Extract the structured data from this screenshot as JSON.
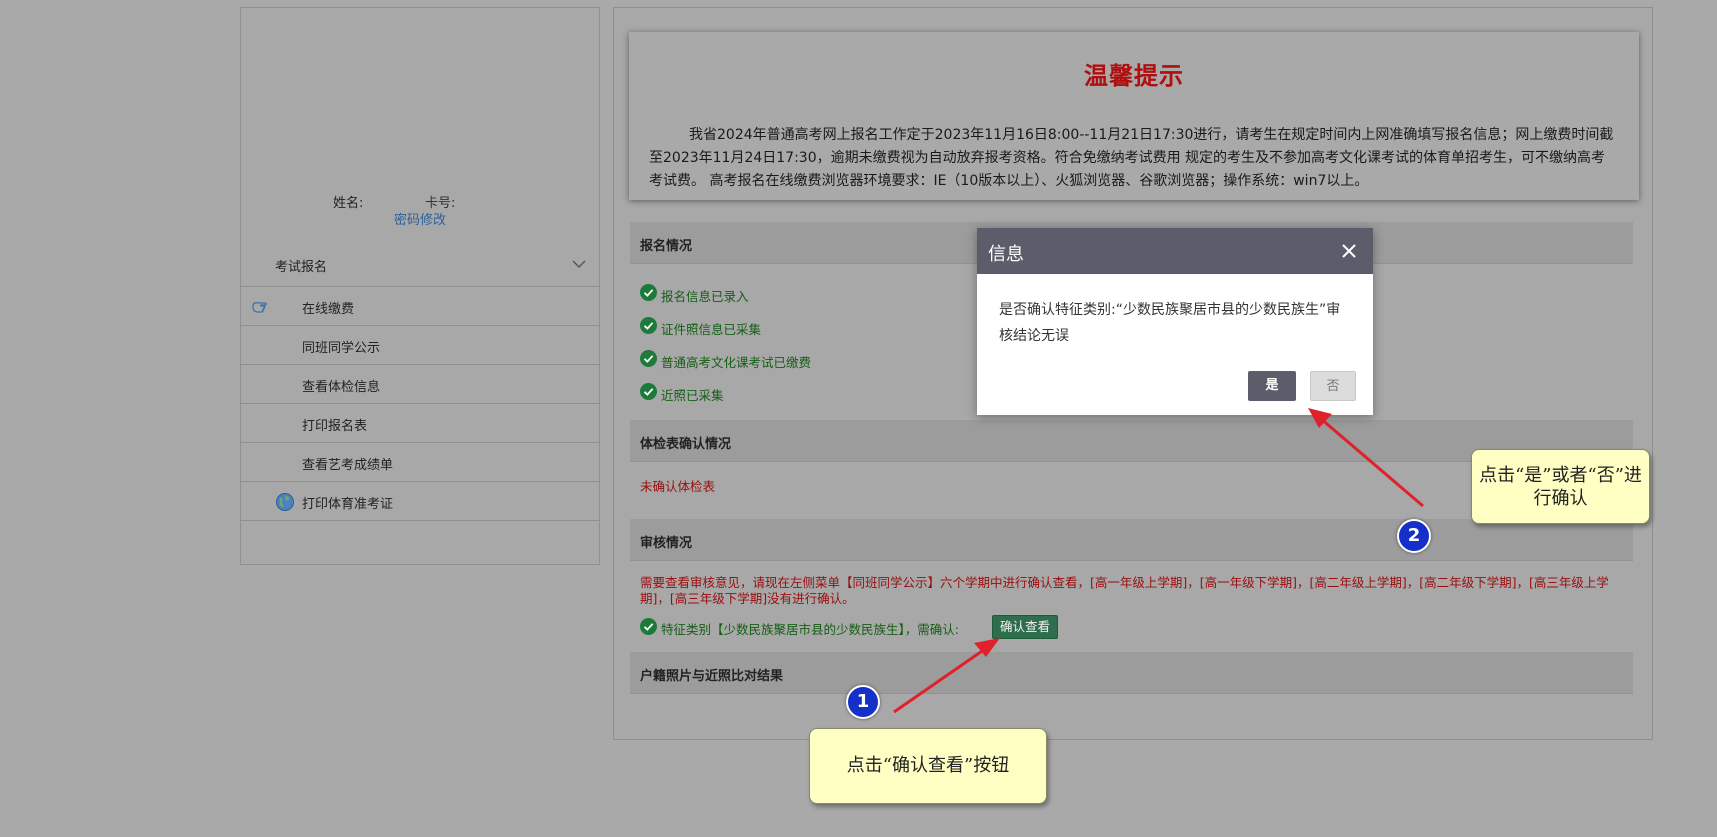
{
  "sidebar": {
    "name_label": "姓名:",
    "card_label": "卡号:",
    "password_link": "密码修改",
    "menu_header": "考试报名",
    "items": [
      {
        "label": "在线缴费",
        "icon": "hand-pointer-icon"
      },
      {
        "label": "同班同学公示",
        "icon": ""
      },
      {
        "label": "查看体检信息",
        "icon": ""
      },
      {
        "label": "打印报名表",
        "icon": ""
      },
      {
        "label": "查看艺考成绩单",
        "icon": ""
      },
      {
        "label": "打印体育准考证",
        "icon": "globe-icon"
      }
    ]
  },
  "notice": {
    "title": "温馨提示",
    "body": "我省2024年普通高考网上报名工作定于2023年11月16日8:00--11月21日17:30进行，请考生在规定时间内上网准确填写报名信息；网上缴费时间截至2023年11月24日17:30，逾期未缴费视为自动放弃报考资格。符合免缴纳考试费用 规定的考生及不参加高考文化课考试的体育单招考生，可不缴纳高考考试费。 高考报名在线缴费浏览器环境要求：IE（10版本以上）、火狐浏览器、谷歌浏览器；操作系统：win7以上。"
  },
  "registration": {
    "header": "报名情况",
    "statuses": [
      "报名信息已录入",
      "证件照信息已采集",
      "普通高考文化课考试已缴费",
      "近照已采集"
    ]
  },
  "physical_exam": {
    "header": "体检表确认情况",
    "status": "未确认体检表"
  },
  "review": {
    "header": "审核情况",
    "note": "需要查看审核意见，请现在左侧菜单【同班同学公示】六个学期中进行确认查看，[高一年级上学期]，[高一年级下学期]，[高二年级上学期]，[高二年级下学期]，[高三年级上学期]，[高三年级下学期]没有进行确认。",
    "feature_text": "特征类别【少数民族聚居市县的少数民族生】，需确认:",
    "confirm_button": "确认查看"
  },
  "photo_compare": {
    "header": "户籍照片与近照比对结果"
  },
  "dialog": {
    "title": "信息",
    "message": "是否确认特征类别:“少数民族聚居市县的少数民族生”审核结论无误",
    "yes": "是",
    "no": "否"
  },
  "annotations": {
    "callout_1": "点击“确认查看”按钮",
    "callout_2": "点击“是”或者“否”进行确认",
    "badge_1": "1",
    "badge_2": "2"
  },
  "colors": {
    "overlay_gray": "#a9a9a9",
    "notice_title_red": "#b00f0f",
    "status_green": "#155e15",
    "dialog_header": "#5b5e6a",
    "confirm_button": "#2e6e4c",
    "callout_yellow": "#ffffc4",
    "badge_blue": "#1430c8",
    "arrow_red": "#e0202a"
  }
}
